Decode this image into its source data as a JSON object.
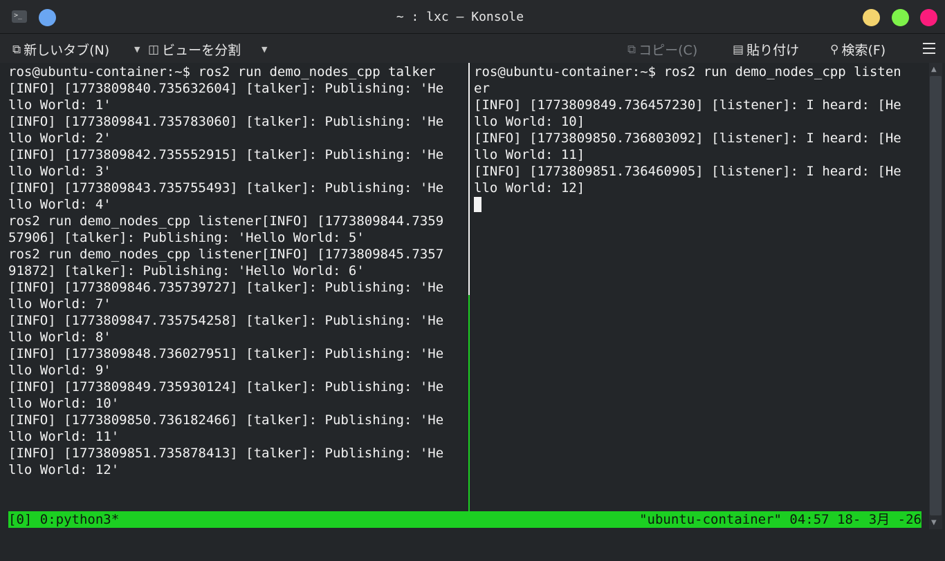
{
  "window": {
    "title": "~ : lxc — Konsole",
    "app_icon": "terminal-icon",
    "colors": {
      "minimize": "#f3d36e",
      "maximize": "#7ef24a",
      "close": "#fb1c7c"
    }
  },
  "toolbar": {
    "new_tab": "新しいタブ(N)",
    "split_view": "ビューを分割",
    "copy": "コピー(C)",
    "paste": "貼り付け",
    "search": "検索(F)"
  },
  "terminal_left": {
    "lines": [
      "ros@ubuntu-container:~$ ros2 run demo_nodes_cpp talker",
      "[INFO] [1773809840.735632604] [talker]: Publishing: 'He",
      "llo World: 1'",
      "[INFO] [1773809841.735783060] [talker]: Publishing: 'He",
      "llo World: 2'",
      "[INFO] [1773809842.735552915] [talker]: Publishing: 'He",
      "llo World: 3'",
      "[INFO] [1773809843.735755493] [talker]: Publishing: 'He",
      "llo World: 4'",
      "ros2 run demo_nodes_cpp listener[INFO] [1773809844.7359",
      "57906] [talker]: Publishing: 'Hello World: 5'",
      "ros2 run demo_nodes_cpp listener[INFO] [1773809845.7357",
      "91872] [talker]: Publishing: 'Hello World: 6'",
      "[INFO] [1773809846.735739727] [talker]: Publishing: 'He",
      "llo World: 7'",
      "[INFO] [1773809847.735754258] [talker]: Publishing: 'He",
      "llo World: 8'",
      "[INFO] [1773809848.736027951] [talker]: Publishing: 'He",
      "llo World: 9'",
      "[INFO] [1773809849.735930124] [talker]: Publishing: 'He",
      "llo World: 10'",
      "[INFO] [1773809850.736182466] [talker]: Publishing: 'He",
      "llo World: 11'",
      "[INFO] [1773809851.735878413] [talker]: Publishing: 'He",
      "llo World: 12'"
    ]
  },
  "terminal_right": {
    "lines": [
      "ros@ubuntu-container:~$ ros2 run demo_nodes_cpp listen",
      "er",
      "[INFO] [1773809849.736457230] [listener]: I heard: [He",
      "llo World: 10]",
      "[INFO] [1773809850.736803092] [listener]: I heard: [He",
      "llo World: 11]",
      "[INFO] [1773809851.736460905] [listener]: I heard: [He",
      "llo World: 12]"
    ]
  },
  "statusbar": {
    "left": "[0] 0:python3*",
    "right": "\"ubuntu-container\" 04:57 18- 3月 -26",
    "color": "#1ccf22"
  }
}
